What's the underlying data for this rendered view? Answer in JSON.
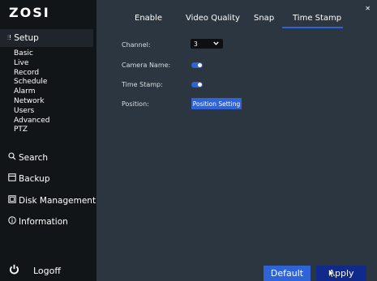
{
  "brand": {
    "logo_text": "ZOSI"
  },
  "sidebar": {
    "setup_label": "Setup",
    "sub_items": [
      "Basic",
      "Live",
      "Record",
      "Schedule",
      "Alarm",
      "Network",
      "Users",
      "Advanced",
      "PTZ"
    ],
    "search_label": "Search",
    "backup_label": "Backup",
    "disk_label": "Disk Management",
    "info_label": "Information",
    "logoff_label": "Logoff"
  },
  "tabs": [
    "Enable",
    "Video Quality",
    "Snap",
    "Time Stamp"
  ],
  "active_tab": "Time Stamp",
  "form": {
    "channel_label": "Channel:",
    "channel_value": "3",
    "camera_name_label": "Camera Name:",
    "camera_name_enabled": true,
    "time_stamp_label": "Time Stamp:",
    "time_stamp_enabled": true,
    "position_label": "Position:",
    "position_button": "Position Setting"
  },
  "footer": {
    "default_label": "Default",
    "apply_label": "Apply"
  },
  "icons": {
    "setup": "sliders-icon",
    "search": "search-icon",
    "backup": "backup-icon",
    "disk": "disk-icon",
    "info": "info-icon",
    "logoff": "power-icon",
    "close": "close-icon",
    "dropdown": "chevron-down-icon",
    "cursor": "cursor-icon"
  },
  "colors": {
    "accent": "#2f63d8",
    "apply_bg": "#0f2a8a",
    "panel_bg": "#2c3640",
    "sidebar_bg": "#121518"
  }
}
